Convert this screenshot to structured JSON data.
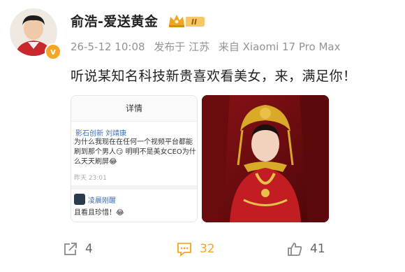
{
  "post": {
    "author": "俞浩-爱送黄金",
    "badge_text": "II",
    "time": "26-5-12 10:08",
    "published_from": "发布于 江苏",
    "location": "江苏",
    "source": "来自 Xiaomi 17 Pro Max",
    "text": "听说某知名科技新贵喜欢看美女，来，满足你！"
  },
  "image1": {
    "header": "详情",
    "user": "影石创新 刘靖康",
    "body": "为什么我现在在任何一个视频平台都能刷到那个男人😏 明明不是美女CEO为什么天天刷屏😂",
    "time": "昨天 23:01",
    "reply_user": "凌晨刚醒",
    "reply_text": "且看且珍惜！😂"
  },
  "actions": {
    "share_count": "4",
    "comment_count": "32",
    "like_count": "41"
  },
  "colors": {
    "brand": "#f5a623",
    "link": "#5b8dc9",
    "meta": "#939393"
  },
  "icons": [
    "verified-badge-icon",
    "vip-crown-icon",
    "share-icon",
    "comment-icon",
    "like-icon"
  ]
}
